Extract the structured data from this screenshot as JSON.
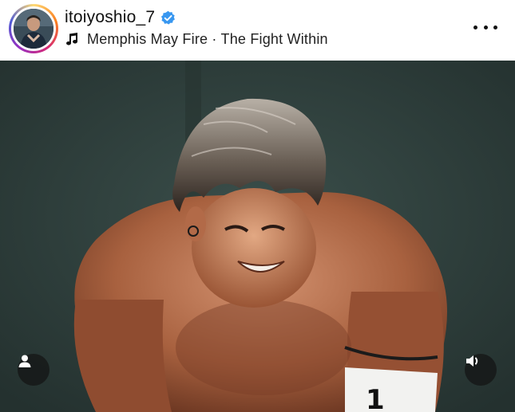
{
  "post": {
    "username": "itoiyoshio_7",
    "verified": true,
    "audio": "Memphis May Fire · The Fight Within"
  },
  "icons": {
    "verified": "verified-badge-icon",
    "music": "music-note-icon",
    "more": "more-options-icon",
    "tagged_user": "user-icon",
    "sound": "speaker-icon"
  },
  "media": {
    "armband_number": "1"
  },
  "colors": {
    "verified_blue": "#3897f0",
    "text": "#111111",
    "overlay_button": "#141414"
  }
}
